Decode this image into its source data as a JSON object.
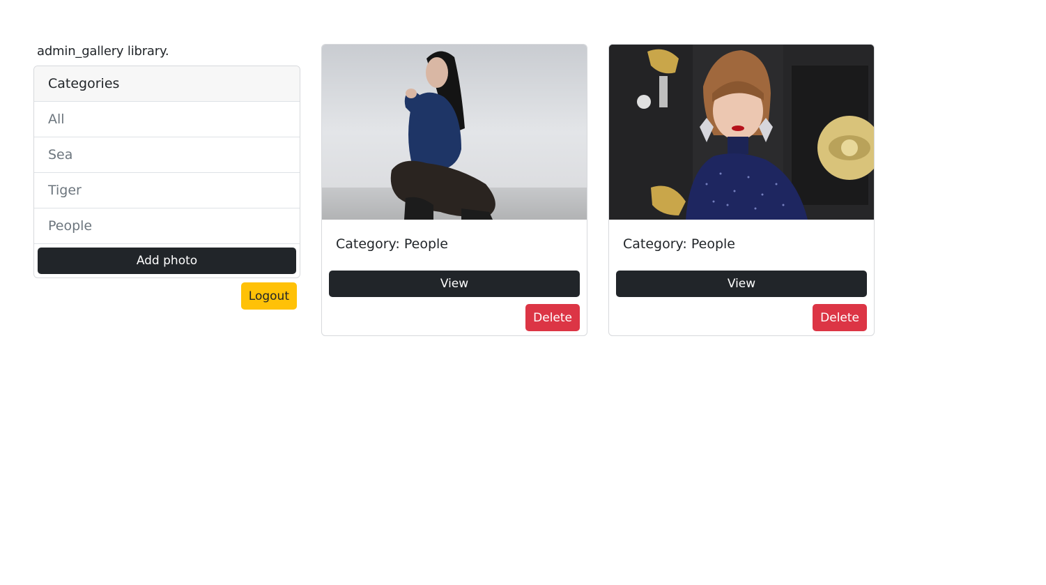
{
  "greeting": "admin_gallery library.",
  "categories": {
    "header": "Categories",
    "items": [
      {
        "label": "All"
      },
      {
        "label": "Sea"
      },
      {
        "label": "Tiger"
      },
      {
        "label": "People"
      }
    ]
  },
  "actions": {
    "add_photo_label": "Add photo",
    "logout_label": "Logout"
  },
  "photos": [
    {
      "category_text": "Category: People",
      "view_label": "View",
      "delete_label": "Delete"
    },
    {
      "category_text": "Category: People",
      "view_label": "View",
      "delete_label": "Delete"
    }
  ],
  "colors": {
    "dark_button": "#212529",
    "logout_button": "#ffc107",
    "delete_button": "#dc3545"
  }
}
